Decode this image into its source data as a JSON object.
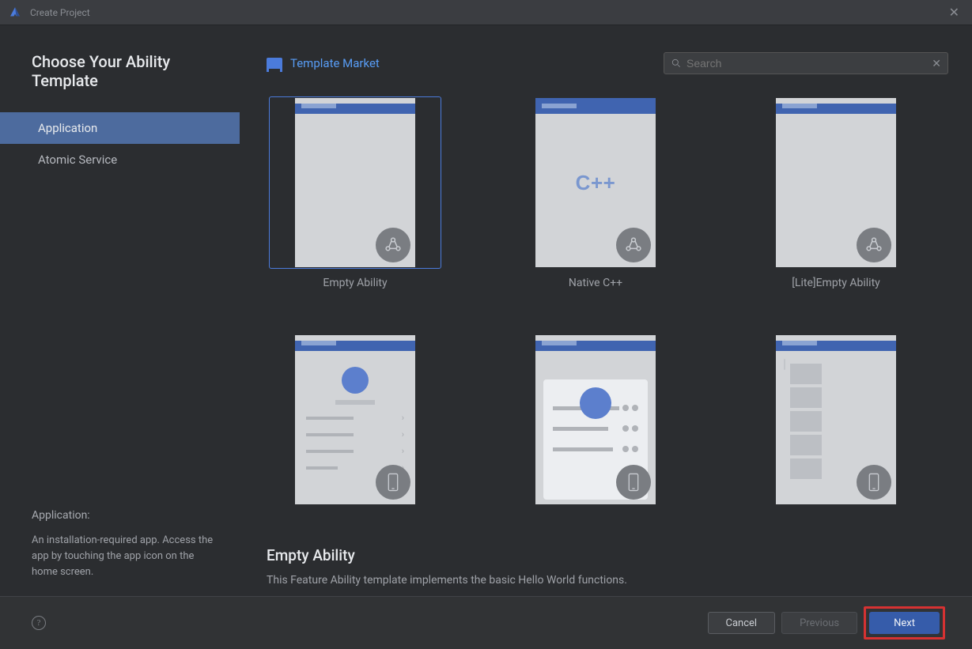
{
  "window": {
    "title": "Create Project"
  },
  "page": {
    "title": "Choose Your Ability Template"
  },
  "sidebar": {
    "tabs": [
      {
        "label": "Application",
        "active": true
      },
      {
        "label": "Atomic Service",
        "active": false
      }
    ],
    "desc_title": "Application:",
    "desc_text": "An installation-required app. Access the app by touching the app icon on the home screen."
  },
  "market": {
    "label": "Template Market"
  },
  "search": {
    "placeholder": "Search"
  },
  "templates": [
    {
      "name": "Empty Ability",
      "variant": "empty",
      "badge": "ring",
      "selected": true
    },
    {
      "name": "Native C++",
      "variant": "cpp",
      "badge": "ring"
    },
    {
      "name": "[Lite]Empty Ability",
      "variant": "empty",
      "badge": "ring"
    },
    {
      "name": "",
      "variant": "row2a",
      "badge": "phone"
    },
    {
      "name": "",
      "variant": "row2b",
      "badge": "phone"
    },
    {
      "name": "",
      "variant": "row2c",
      "badge": "phone"
    }
  ],
  "info": {
    "title": "Empty Ability",
    "desc": "This Feature Ability template implements the basic Hello World functions."
  },
  "buttons": {
    "cancel": "Cancel",
    "previous": "Previous",
    "next": "Next"
  }
}
